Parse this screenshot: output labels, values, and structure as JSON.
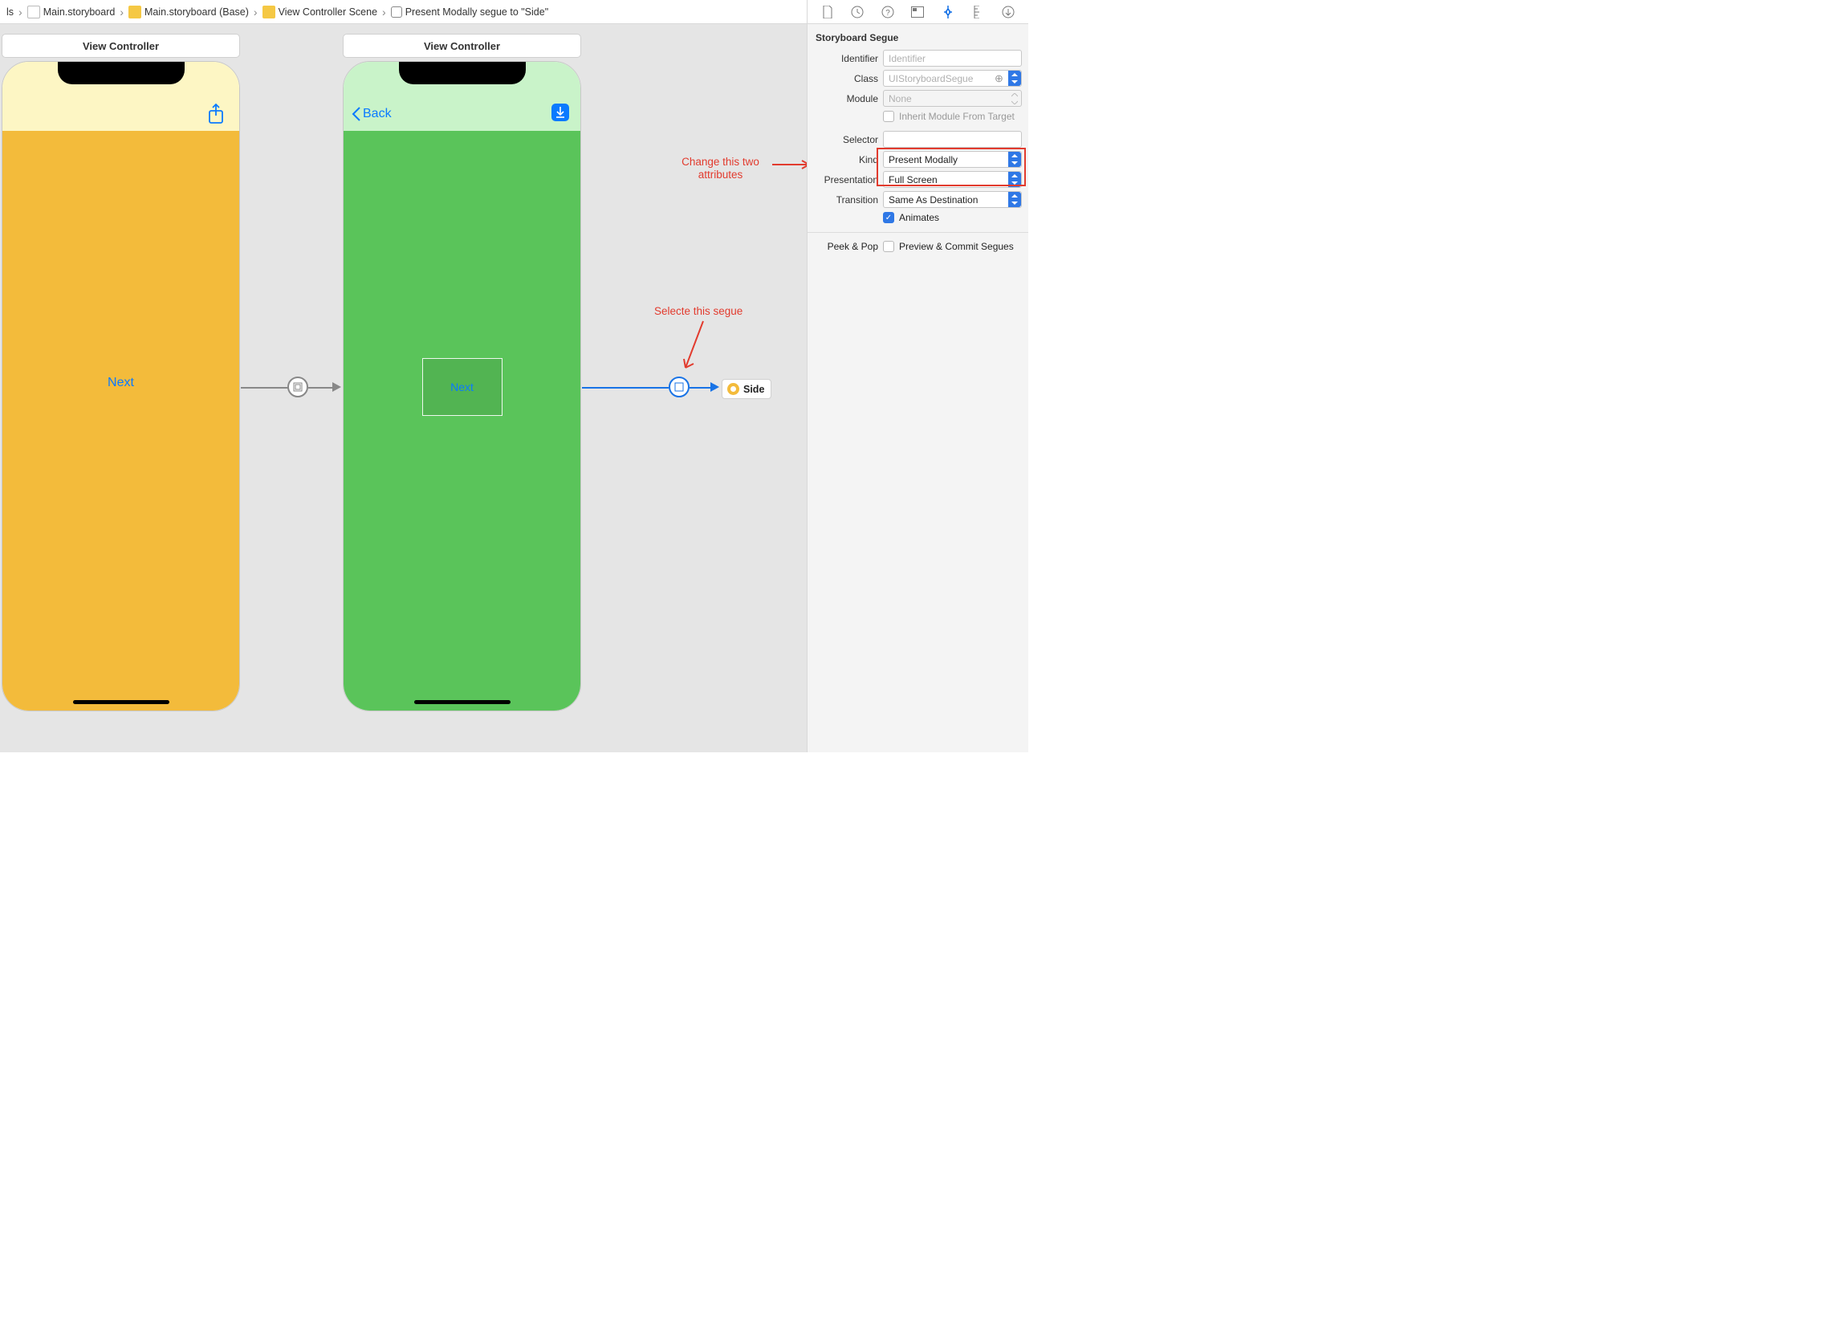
{
  "breadcrumbs": {
    "item0": "ls",
    "item1": "Main.storyboard",
    "item2": "Main.storyboard (Base)",
    "item3": "View Controller Scene",
    "item4": "Present Modally segue to \"Side\""
  },
  "canvas": {
    "vc1_title": "View Controller",
    "vc1_next": "Next",
    "vc2_title": "View Controller",
    "vc2_back": "Back",
    "vc2_next": "Next",
    "side_label": "Side",
    "annot_attributes": "Change this two\nattributes",
    "annot_segue": "Selecte this segue"
  },
  "inspector": {
    "header": "Storyboard Segue",
    "identifier_label": "Identifier",
    "identifier_placeholder": "Identifier",
    "class_label": "Class",
    "class_value": "UIStoryboardSegue",
    "module_label": "Module",
    "module_value": "None",
    "inherit_label": "Inherit Module From Target",
    "selector_label": "Selector",
    "kind_label": "Kind",
    "kind_value": "Present Modally",
    "presentation_label": "Presentation",
    "presentation_value": "Full Screen",
    "transition_label": "Transition",
    "transition_value": "Same As Destination",
    "animates_label": "Animates",
    "peek_label": "Peek & Pop",
    "peek_value": "Preview & Commit Segues"
  }
}
